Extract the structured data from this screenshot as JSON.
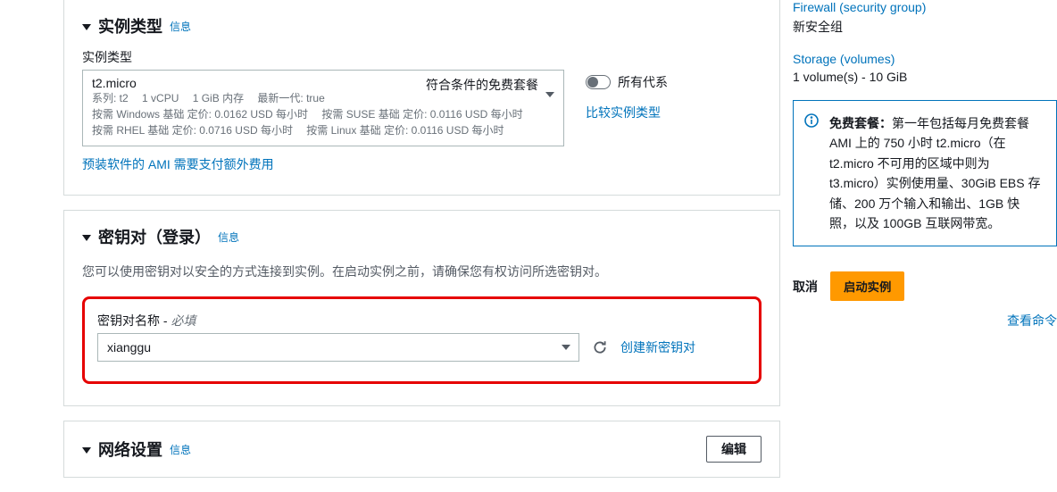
{
  "instance_panel": {
    "title": "实例类型",
    "info": "信息",
    "field_label": "实例类型",
    "selected": {
      "name": "t2.micro",
      "badge": "符合条件的免费套餐",
      "meta": {
        "family": "系列: t2",
        "vcpu": "1 vCPU",
        "mem": "1 GiB 内存",
        "current_gen": "最新一代: true"
      },
      "pricing_line1": {
        "a": "按需 Windows 基础 定价: 0.0162 USD 每小时",
        "b": "按需 SUSE 基础 定价: 0.0116 USD 每小时"
      },
      "pricing_line2": {
        "a": "按需 RHEL 基础 定价: 0.0716 USD 每小时",
        "b": "按需 Linux 基础 定价: 0.0116 USD 每小时"
      }
    },
    "all_generations": "所有代系",
    "compare_link": "比较实例类型",
    "ami_fee_note": "预装软件的 AMI 需要支付额外费用"
  },
  "keypair_panel": {
    "title": "密钥对（登录）",
    "info": "信息",
    "desc": "您可以使用密钥对以安全的方式连接到实例。在启动实例之前，请确保您有权访问所选密钥对。",
    "label": "密钥对名称",
    "required": "必填",
    "value": "xianggu",
    "create_link": "创建新密钥对"
  },
  "network_panel": {
    "title": "网络设置",
    "info": "信息",
    "edit_btn": "编辑"
  },
  "sidebar": {
    "firewall": {
      "title": "Firewall (security group)",
      "value": "新安全组"
    },
    "storage": {
      "title": "Storage (volumes)",
      "value": "1 volume(s) - 10 GiB"
    },
    "free_tier": {
      "label": "免费套餐：",
      "text": "第一年包括每月免费套餐 AMI 上的 750 小时 t2.micro（在 t2.micro 不可用的区域中则为 t3.micro）实例使用量、30GiB EBS 存储、200 万个输入和输出、1GB 快照，以及 100GB 互联网带宽。"
    },
    "cancel": "取消",
    "launch": "启动实例",
    "view_cmd": "查看命令"
  }
}
